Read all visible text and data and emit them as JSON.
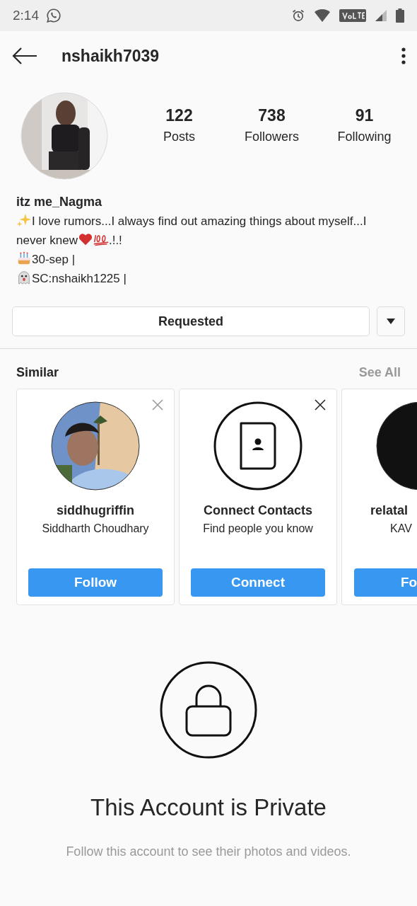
{
  "status_bar": {
    "time": "2:14"
  },
  "header": {
    "username": "nshaikh7039"
  },
  "profile": {
    "avatar": {
      "kind": "picture"
    },
    "stats": [
      {
        "value": "122",
        "label": "Posts"
      },
      {
        "value": "738",
        "label": "Followers"
      },
      {
        "value": "91",
        "label": "Following"
      }
    ],
    "display_name": "itz me_Nagma",
    "bio": [
      [
        {
          "kind": "sparkles"
        },
        {
          "kind": "text",
          "text": "I love rumors...I always find out amazing things about myself...I"
        }
      ],
      [
        {
          "kind": "text",
          "text": "never knew"
        },
        {
          "kind": "heart"
        },
        {
          "kind": "hundred"
        },
        {
          "kind": "text",
          "text": ".!.!"
        }
      ],
      [
        {
          "kind": "cake"
        },
        {
          "kind": "text",
          "text": "30-sep |"
        }
      ],
      [
        {
          "kind": "ghost"
        },
        {
          "kind": "text",
          "text": "SC:nshaikh1225 |"
        }
      ]
    ]
  },
  "actions": {
    "primary": "Requested"
  },
  "similar": {
    "title": "Similar",
    "see_all": "See All",
    "cards": [
      {
        "kind": "user",
        "title": "siddhugriffin",
        "subtitle": "Siddharth Choudhary",
        "button": "Follow"
      },
      {
        "kind": "contacts",
        "title": "Connect Contacts",
        "subtitle": "Find people you know",
        "button": "Connect"
      },
      {
        "kind": "user",
        "title": "relatal",
        "subtitle": "KAV",
        "button": "Fo"
      }
    ]
  },
  "private": {
    "title": "This Account is Private",
    "message": "Follow this account to see their photos and videos."
  }
}
